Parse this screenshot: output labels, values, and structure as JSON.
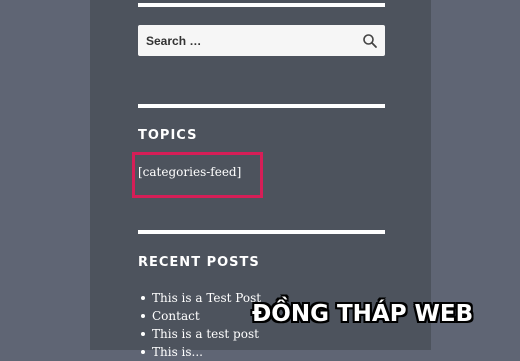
{
  "search": {
    "placeholder": "Search …",
    "button_icon": "search-icon"
  },
  "topics_widget": {
    "title": "TOPICS",
    "content": "[categories-feed]",
    "highlight_color": "#d61e57"
  },
  "recent_posts_widget": {
    "title": "RECENT POSTS",
    "posts": [
      "This is a Test Post",
      "Contact",
      "This is a test post",
      "This is..."
    ]
  },
  "watermark": "ĐỒNG THÁP WEB",
  "colors": {
    "page_background": "#5f6574",
    "sidebar_background": "#4d535d",
    "text": "#ffffff"
  }
}
